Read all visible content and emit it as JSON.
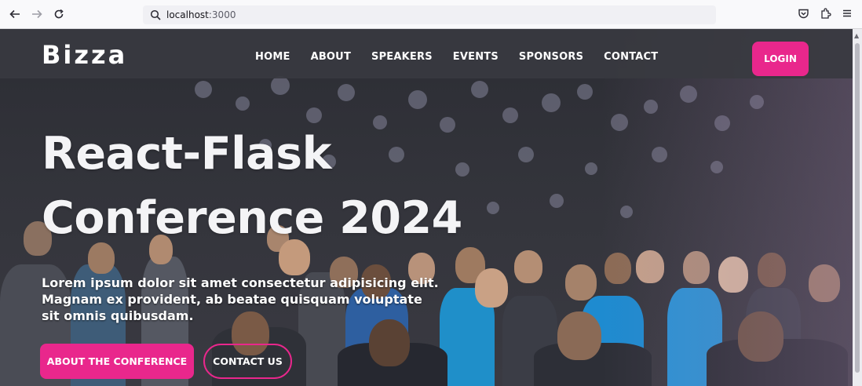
{
  "browser": {
    "url_host": "localhost",
    "url_port": ":3000"
  },
  "header": {
    "logo": "Bizza",
    "nav": [
      "HOME",
      "ABOUT",
      "SPEAKERS",
      "EVENTS",
      "SPONSORS",
      "CONTACT"
    ],
    "login_label": "LOGIN"
  },
  "hero": {
    "title_line1": "React-Flask",
    "title_line2": "Conference 2024",
    "text": "Lorem ipsum dolor sit amet consectetur adipisicing elit. Magnam ex provident, ab beatae quisquam voluptate sit omnis quibusdam.",
    "primary_button": "ABOUT THE CONFERENCE",
    "secondary_button": "CONTACT US"
  },
  "colors": {
    "accent": "#e9278c",
    "header_bg": "#383940"
  },
  "icons": [
    "back-arrow-icon",
    "forward-arrow-icon",
    "reload-icon",
    "search-icon",
    "pocket-icon",
    "extensions-icon",
    "menu-icon"
  ]
}
